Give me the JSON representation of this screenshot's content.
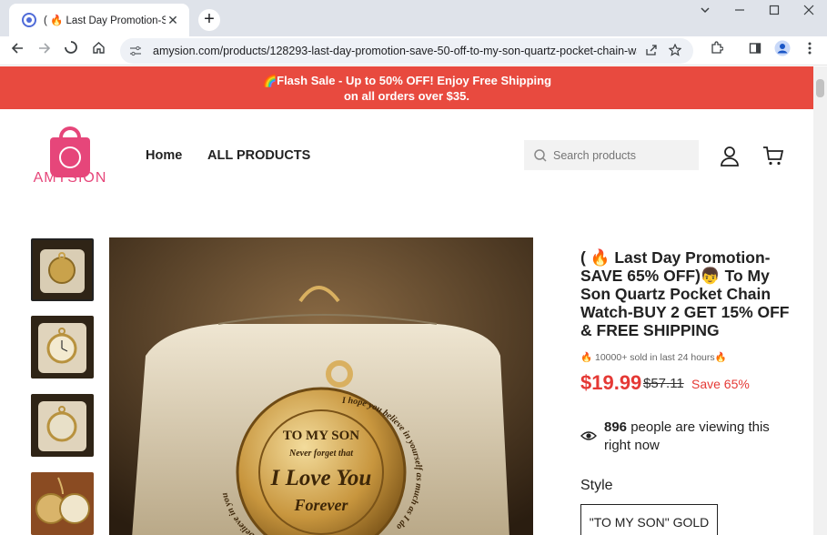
{
  "browser": {
    "tab_title": "( 🔥 Last Day Promotion-SAVE 65% OFF)",
    "tab_close": "✕",
    "new_tab": "+",
    "url": "amysion.com/products/128293-last-day-promotion-save-50-off-to-my-son-quartz-pocket-chain-watch-b..."
  },
  "promo": {
    "line1": "🌈Flash Sale - Up to 50% OFF! Enjoy Free Shipping",
    "line2": "on all orders over $35."
  },
  "header": {
    "logo_text": "AMYSION",
    "nav": [
      "Home",
      "ALL PRODUCTS"
    ],
    "search_placeholder": "Search products"
  },
  "product": {
    "title": "( 🔥 Last Day Promotion-SAVE 65% OFF)👦 To My Son Quartz Pocket Chain Watch-BUY 2 GET 15% OFF & FREE SHIPPING",
    "sold": "🔥 10000+ sold in last 24 hours🔥",
    "price": "$19.99",
    "compare_price": "$57.11",
    "save": "Save 65%",
    "viewing_count": "896",
    "viewing_text": "people are viewing this right now",
    "style_label": "Style",
    "style_selected": "\"TO MY SON\" GOLD",
    "watch_engraving": {
      "line1": "TO MY SON",
      "line2": "Never forget that",
      "line3": "I Love You",
      "line4": "Forever",
      "ring_left": "I believe in you",
      "ring_right": "I hope you believe in yourself as much as I do"
    }
  }
}
